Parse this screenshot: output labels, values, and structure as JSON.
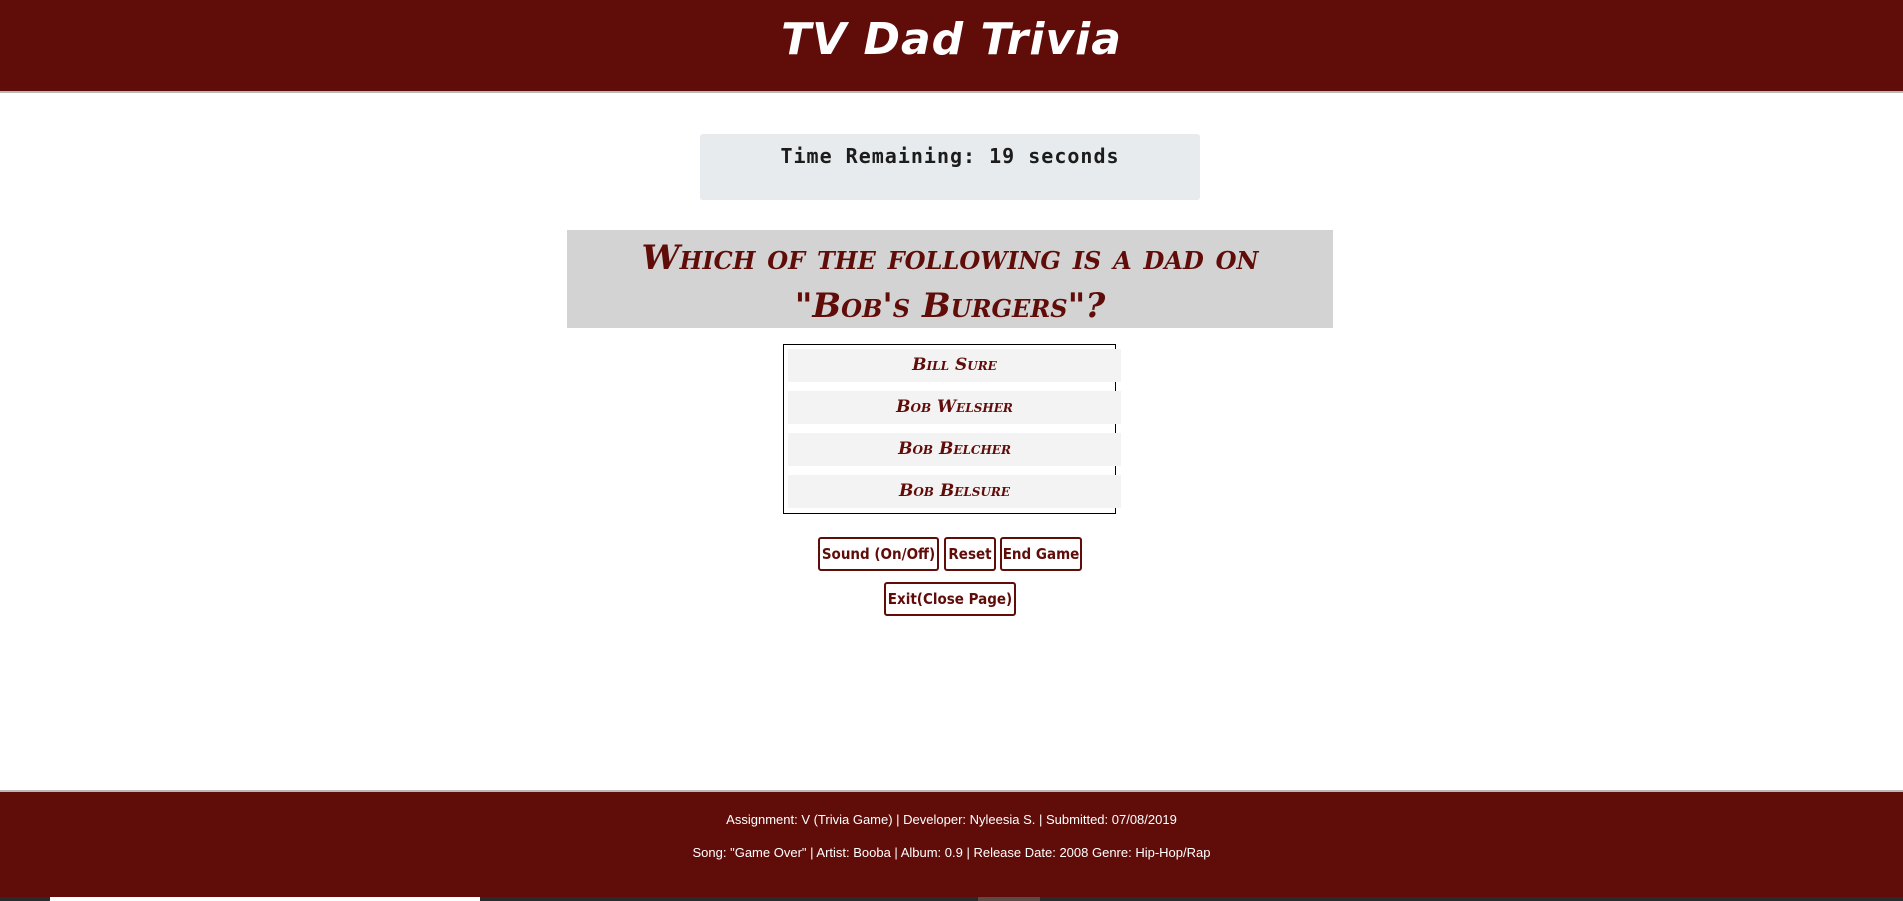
{
  "header": {
    "title": "TV Dad Trivia"
  },
  "timer": {
    "text": "Time Remaining: 19 seconds"
  },
  "question": {
    "text": "Which of the following is a dad on \"Bob's Burgers\"?"
  },
  "answers": [
    "Bill Sure",
    "Bob Welsher",
    "Bob Belcher",
    "Bob Belsure"
  ],
  "controls": {
    "sound_label": "Sound (On/Off)",
    "reset_label": "Reset",
    "end_label": "End Game",
    "exit_label": "Exit(Close Page)"
  },
  "footer": {
    "line1": "Assignment: V (Trivia Game) | Developer: Nyleesia S. | Submitted: 07/08/2019",
    "line2": "Song: \"Game Over\" | Artist: Booba | Album: 0.9 | Release Date: 2008 Genre: Hip-Hop/Rap"
  },
  "colors": {
    "brand": "#600d0a",
    "timer_bg": "#e7ebee",
    "question_bg": "#d3d3d3",
    "answer_bg": "#f3f3f3"
  }
}
